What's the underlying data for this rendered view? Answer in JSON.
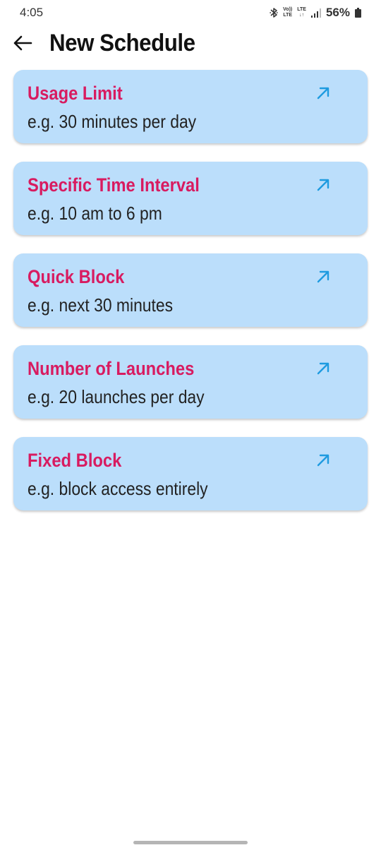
{
  "status_bar": {
    "time": "4:05",
    "volte_top": "Vo))",
    "volte_bottom": "LTE",
    "lte_top": "LTE",
    "lte_bottom": "↓↑",
    "battery": "56%",
    "icons": [
      "bluetooth-icon",
      "volte-icon",
      "lte-data-icon",
      "signal-icon",
      "battery-icon"
    ]
  },
  "header": {
    "title": "New Schedule",
    "back_icon": "arrow-left-icon"
  },
  "colors": {
    "card_background": "#bbdefb",
    "card_title": "#d81b60",
    "arrow_icon": "#1e9be0",
    "text_primary": "#111111"
  },
  "schedule_types": [
    {
      "title": "Usage Limit",
      "subtitle": "e.g. 30 minutes per day",
      "icon": "arrow-up-right-icon"
    },
    {
      "title": "Specific Time Interval",
      "subtitle": "e.g. 10 am to 6 pm",
      "icon": "arrow-up-right-icon"
    },
    {
      "title": "Quick Block",
      "subtitle": "e.g. next 30 minutes",
      "icon": "arrow-up-right-icon"
    },
    {
      "title": "Number of Launches",
      "subtitle": "e.g. 20 launches per day",
      "icon": "arrow-up-right-icon"
    },
    {
      "title": "Fixed Block",
      "subtitle": "e.g. block access entirely",
      "icon": "arrow-up-right-icon"
    }
  ]
}
